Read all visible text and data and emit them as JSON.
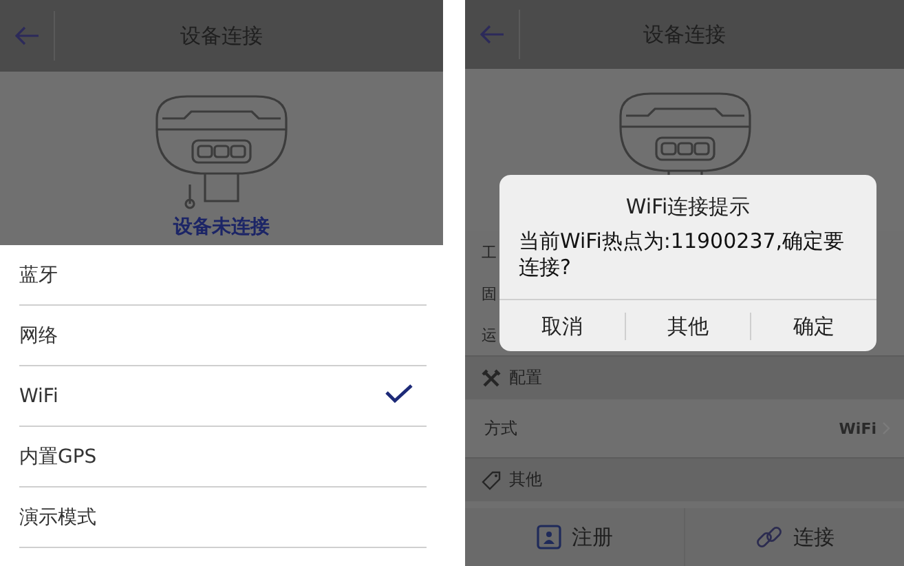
{
  "left_screen": {
    "title": "设备连接",
    "device_status": "设备未连接",
    "options": [
      {
        "label": "蓝牙",
        "selected": false
      },
      {
        "label": "网络",
        "selected": false
      },
      {
        "label": "WiFi",
        "selected": true
      },
      {
        "label": "内置GPS",
        "selected": false
      },
      {
        "label": "演示模式",
        "selected": false
      }
    ]
  },
  "right_screen": {
    "title": "设备连接",
    "info_rows": [
      "工",
      "固",
      "运"
    ],
    "sections": [
      {
        "title": "配置",
        "kind": "tools",
        "rows": [
          {
            "label": "方式",
            "value": "WiFi"
          }
        ]
      },
      {
        "title": "其他",
        "kind": "tag"
      }
    ],
    "bottom_buttons": [
      {
        "label": "注册",
        "kind": "register"
      },
      {
        "label": "连接",
        "kind": "link"
      }
    ],
    "dialog": {
      "title": "WiFi连接提示",
      "message": "当前WiFi热点为:11900237,确定要连接?",
      "buttons": [
        "取消",
        "其他",
        "确定"
      ]
    }
  }
}
